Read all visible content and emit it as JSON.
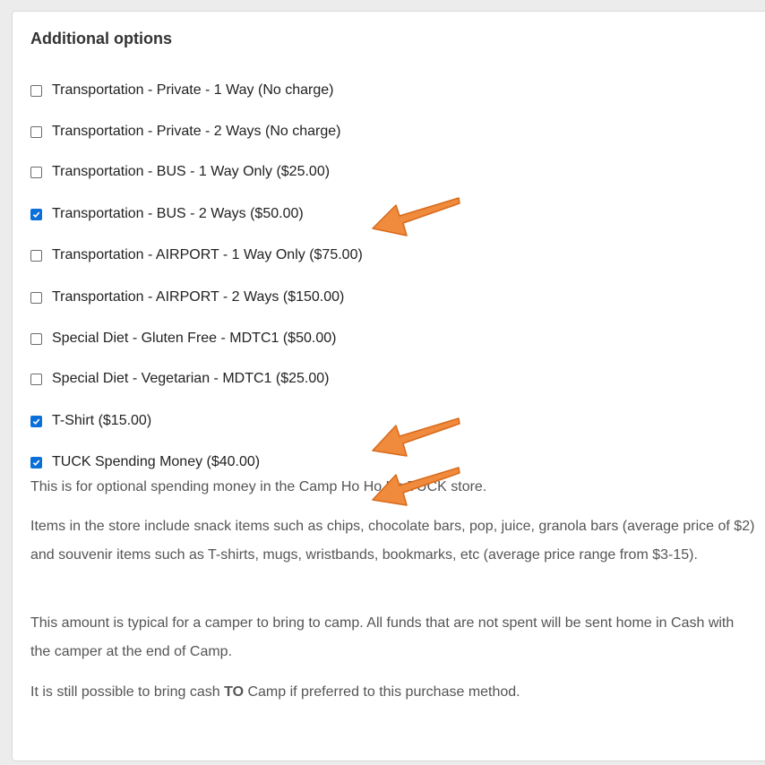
{
  "section": {
    "title": "Additional options"
  },
  "options": [
    {
      "label": "Transportation - Private - 1 Way (No charge)",
      "checked": false
    },
    {
      "label": "Transportation - Private - 2 Ways (No charge)",
      "checked": false
    },
    {
      "label": "Transportation - BUS - 1 Way Only ($25.00)",
      "checked": false
    },
    {
      "label": "Transportation - BUS - 2 Ways ($50.00)",
      "checked": true
    },
    {
      "label": "Transportation - AIRPORT - 1 Way Only ($75.00)",
      "checked": false
    },
    {
      "label": "Transportation - AIRPORT - 2 Ways ($150.00)",
      "checked": false
    },
    {
      "label": "Special Diet - Gluten Free - MDTC1 ($50.00)",
      "checked": false
    },
    {
      "label": "Special Diet - Vegetarian - MDTC1 ($25.00)",
      "checked": false
    },
    {
      "label": "T-Shirt ($15.00)",
      "checked": true
    },
    {
      "label": "TUCK Spending Money ($40.00)",
      "checked": true
    }
  ],
  "tuck_description": {
    "p1": "This is for optional spending money in the Camp Ho Ho Ha TUCK store.",
    "p2": "Items in the store include snack items such as chips, chocolate bars, pop, juice, granola bars (average price of $2) and souvenir items such as T-shirts, mugs, wristbands, bookmarks, etc (average price range from $3-15).",
    "p3": "This amount is typical for a camper to bring to camp. All funds that are not spent will be sent home in Cash with the camper at the end of Camp.",
    "p4_before": "It is still possible to bring cash ",
    "p4_bold": "TO",
    "p4_after": " Camp if preferred to this purchase method."
  },
  "colors": {
    "checkbox_checked": "#0a6fd8",
    "annotation_arrow": "#f08a3c"
  },
  "annotations": [
    "arrow",
    "arrow",
    "arrow"
  ]
}
